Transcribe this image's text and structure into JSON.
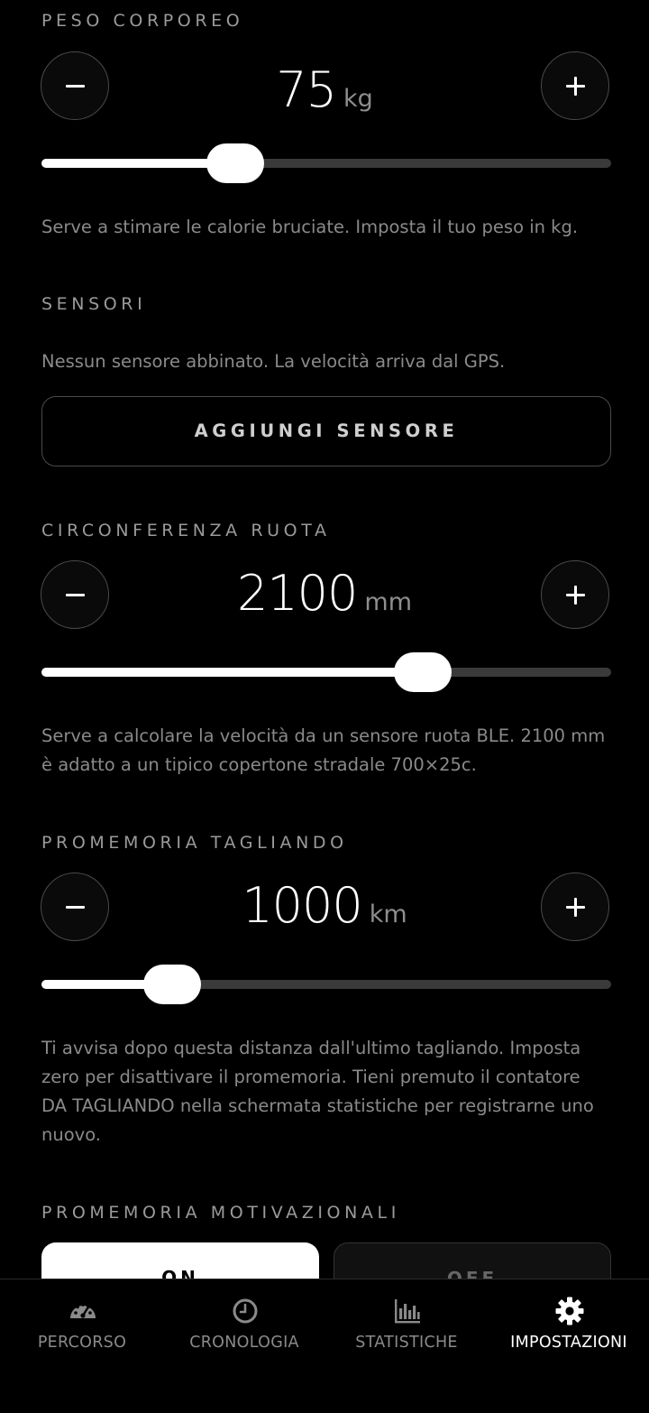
{
  "settings": {
    "weight": {
      "label": "PESO CORPOREO",
      "value": "75",
      "unit": "kg",
      "slider_fraction": 0.34,
      "description": "Serve a stimare le calorie bruciate. Imposta il tuo peso in kg."
    },
    "sensors": {
      "label": "SENSORI",
      "description": "Nessun sensore abbinato. La velocità arriva dal GPS.",
      "add_button": "AGGIUNGI SENSORE"
    },
    "wheel": {
      "label": "CIRCONFERENZA RUOTA",
      "value": "2100",
      "unit": "mm",
      "slider_fraction": 0.67,
      "description": "Serve a calcolare la velocità da un sensore ruota BLE. 2100 mm è adatto a un tipico copertone stradale 700×25c."
    },
    "service": {
      "label": "PROMEMORIA TAGLIANDO",
      "value": "1000",
      "unit": "km",
      "slider_fraction": 0.23,
      "description": "Ti avvisa dopo questa distanza dall'ultimo tagliando. Imposta zero per disattivare il promemoria. Tieni premuto il contatore DA TAGLIANDO nella schermata statistiche per registrarne uno nuovo."
    },
    "motivation": {
      "label": "PROMEMORIA MOTIVAZIONALI",
      "on_label": "ON",
      "off_label": "OFF",
      "selected": "ON"
    }
  },
  "tabbar": {
    "tabs": [
      {
        "label": "PERCORSO",
        "icon": "speedometer-icon",
        "active": false
      },
      {
        "label": "CRONOLOGIA",
        "icon": "clock-icon",
        "active": false
      },
      {
        "label": "STATISTICHE",
        "icon": "bar-chart-icon",
        "active": false
      },
      {
        "label": "IMPOSTAZIONI",
        "icon": "gear-icon",
        "active": true
      }
    ]
  },
  "colors": {
    "background": "#000000",
    "accent": "#ffffff",
    "muted_text": "#8a8a8a",
    "track": "#3a3a3a"
  }
}
